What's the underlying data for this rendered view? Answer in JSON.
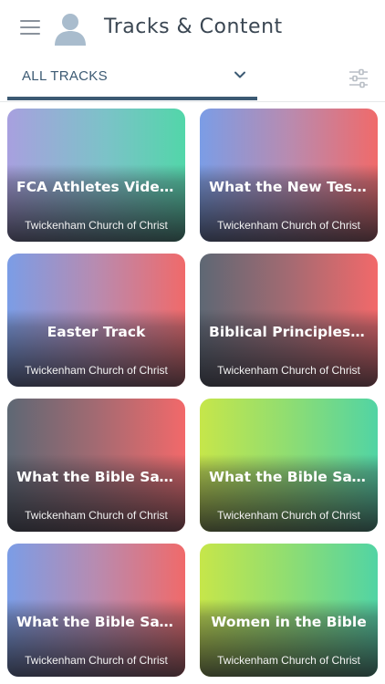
{
  "header": {
    "title": "Tracks & Content",
    "menu_icon": "hamburger-menu-icon",
    "avatar_icon": "user-avatar-icon"
  },
  "filter": {
    "selected": "ALL TRACKS",
    "chevron_icon": "chevron-down-icon",
    "settings_icon": "filter-sliders-icon"
  },
  "colors": {
    "primary": "#3c5a73",
    "icon_gray": "#8a929c"
  },
  "cards": [
    {
      "title": "FCA Athletes Video T...",
      "subtitle": "Twickenham Church of Christ",
      "gradient": "purple-teal"
    },
    {
      "title": "What the New Testa...",
      "subtitle": "Twickenham Church of Christ",
      "gradient": "blue-red"
    },
    {
      "title": "Easter Track",
      "subtitle": "Twickenham Church of Christ",
      "gradient": "blue-red"
    },
    {
      "title": "Biblical Principles for ...",
      "subtitle": "Twickenham Church of Christ",
      "gradient": "gray-red"
    },
    {
      "title": "What the Bible Says ...",
      "subtitle": "Twickenham Church of Christ",
      "gradient": "gray-red"
    },
    {
      "title": "What the Bible Says ...",
      "subtitle": "Twickenham Church of Christ",
      "gradient": "lime-teal"
    },
    {
      "title": "What the Bible Says ...",
      "subtitle": "Twickenham Church of Christ",
      "gradient": "blue-red"
    },
    {
      "title": "Women in the Bible",
      "subtitle": "Twickenham Church of Christ",
      "gradient": "lime-teal"
    }
  ]
}
